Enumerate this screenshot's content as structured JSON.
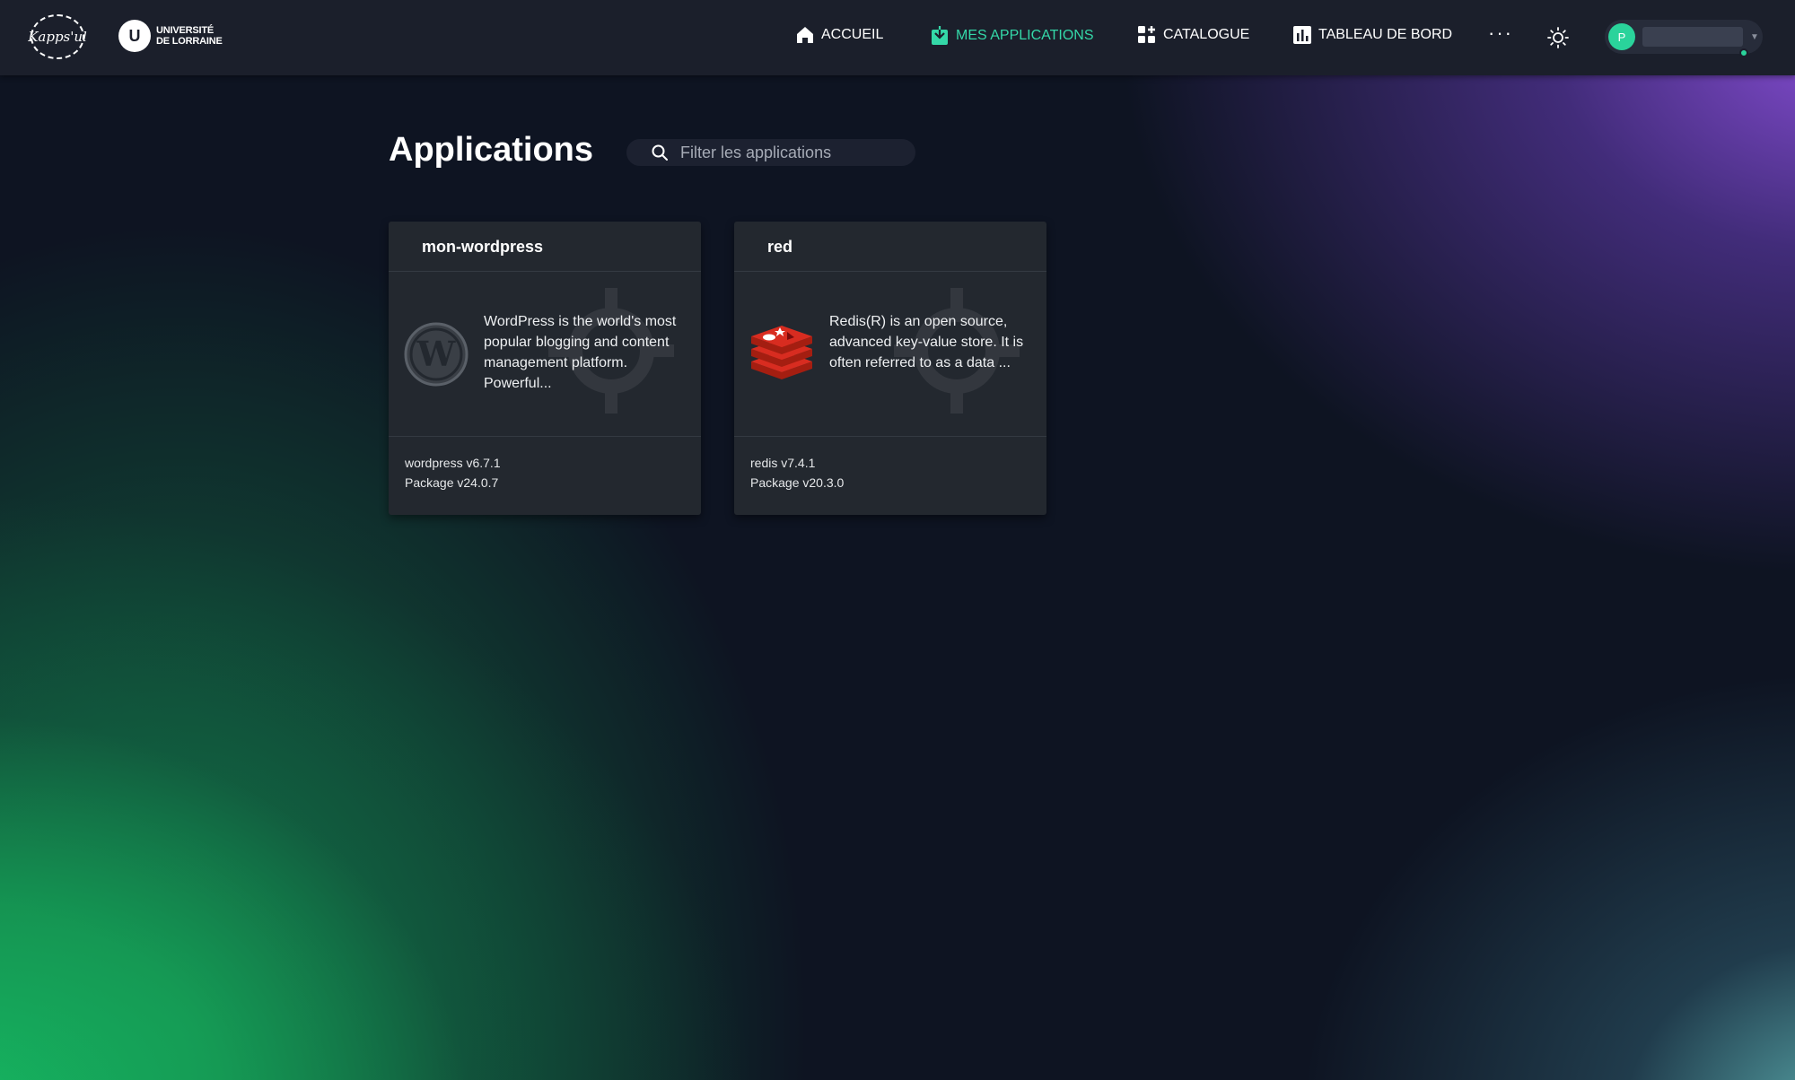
{
  "header": {
    "logo_kapps_text": "Kapps'ul",
    "logo_ul_line1": "UNIVERSITÉ",
    "logo_ul_line2": "DE LORRAINE",
    "logo_ul_mark": "U",
    "nav": [
      {
        "label": "ACCUEIL",
        "icon": "home-icon"
      },
      {
        "label": "MES APPLICATIONS",
        "icon": "download-box-icon",
        "active": true
      },
      {
        "label": "CATALOGUE",
        "icon": "apps-grid-icon"
      },
      {
        "label": "TABLEAU DE BORD",
        "icon": "chart-bar-icon"
      }
    ],
    "more_label": "···",
    "user_initial": "P",
    "caret": "▼"
  },
  "main": {
    "title": "Applications",
    "search": {
      "placeholder": "Filter les applications",
      "value": ""
    }
  },
  "cards": [
    {
      "name": "mon-wordpress",
      "description": "WordPress is the world's most popular blogging and content management platform. Powerful...",
      "app_version": "wordpress v6.7.1",
      "package_version": "Package v24.0.7",
      "icon": "wordpress-logo"
    },
    {
      "name": "red",
      "description": "Redis(R) is an open source, advanced key-value store. It is often referred to as a data ...",
      "app_version": "redis v7.4.1",
      "package_version": "Package v20.3.0",
      "icon": "redis-logo"
    }
  ],
  "colors": {
    "accent": "#34d8a8",
    "header_bg": "#1b1f2b",
    "card_bg": "#23282f",
    "avatar": "#2ad39b"
  }
}
